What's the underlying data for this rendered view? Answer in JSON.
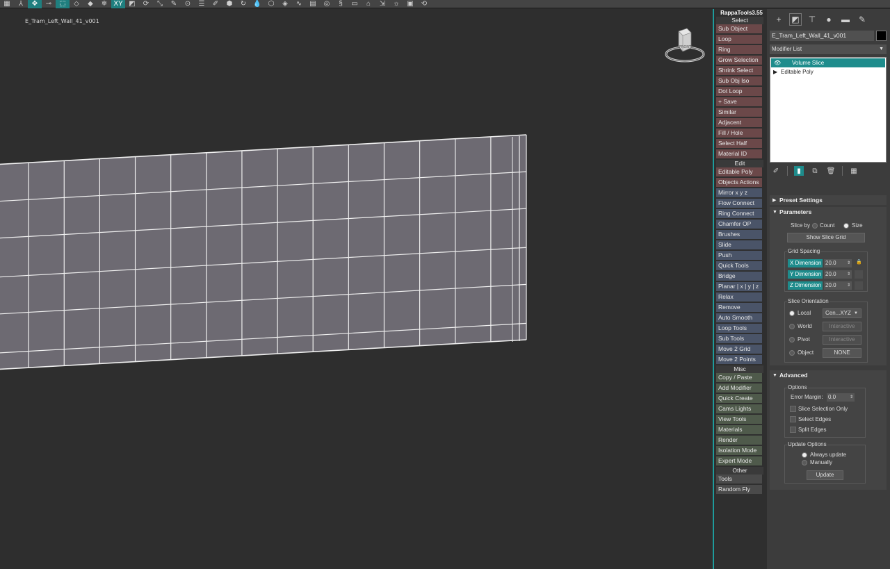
{
  "toolbar": {
    "icons": [
      "grid-icon",
      "select-icon",
      "move-icon",
      "link-icon",
      "select-region-icon",
      "bend-icon",
      "pin-icon",
      "snowflake-icon",
      "xy-icon",
      "snap-icon",
      "rotate-icon",
      "scale-icon",
      "paint-icon",
      "magnet-icon",
      "layers-icon",
      "edit-icon",
      "render-icon",
      "reload-icon",
      "water-icon",
      "cube-green-icon",
      "cube-icon",
      "curve-icon",
      "list-icon",
      "globe-icon",
      "script-icon",
      "box-icon",
      "camera-icon",
      "light-icon",
      "sun-icon",
      "frame-icon",
      "refresh-icon"
    ]
  },
  "viewport": {
    "label": "E_Tram_Left_Wall_41_v001",
    "viewcube_label": "FRONT"
  },
  "rappa": {
    "title": "RappaTools3.55",
    "sections": [
      {
        "header": "Select",
        "buttons": [
          {
            "label": "Sub Object",
            "color": "red"
          },
          {
            "label": "Loop",
            "color": "red"
          },
          {
            "label": "Ring",
            "color": "red"
          },
          {
            "label": "Grow Selection",
            "color": "red"
          },
          {
            "label": "Shrink Select",
            "color": "red"
          },
          {
            "label": "Sub Obj Iso",
            "color": "red"
          },
          {
            "label": "Dot Loop",
            "color": "red"
          },
          {
            "label": "+ Save",
            "color": "red"
          },
          {
            "label": "Similar",
            "color": "red"
          },
          {
            "label": "Adjacent",
            "color": "red"
          },
          {
            "label": "Fill / Hole",
            "color": "red"
          },
          {
            "label": "Select Half",
            "color": "red"
          },
          {
            "label": "Material ID",
            "color": "red"
          }
        ]
      },
      {
        "header": "Edit",
        "buttons": [
          {
            "label": "Editable Poly",
            "color": "red"
          },
          {
            "label": "Objects Actions",
            "color": "red"
          },
          {
            "label": "Mirror   x  y  z",
            "color": "blue"
          },
          {
            "label": "Flow Connect",
            "color": "blue"
          },
          {
            "label": "Ring Connect",
            "color": "blue"
          },
          {
            "label": "Chamfer OP",
            "color": "blue"
          },
          {
            "label": "Brushes",
            "color": "blue"
          },
          {
            "label": "Slide",
            "color": "blue"
          },
          {
            "label": "Push",
            "color": "blue"
          },
          {
            "label": "Quick Tools",
            "color": "blue"
          },
          {
            "label": "Bridge",
            "color": "blue"
          },
          {
            "label": "Planar | x | y | z",
            "color": "blue"
          },
          {
            "label": "Relax",
            "color": "blue"
          },
          {
            "label": "Remove",
            "color": "blue"
          },
          {
            "label": "Auto Smooth",
            "color": "blue"
          },
          {
            "label": "Loop Tools",
            "color": "blue"
          },
          {
            "label": "Sub Tools",
            "color": "blue"
          },
          {
            "label": "Move 2 Grid",
            "color": "blue"
          },
          {
            "label": "Move 2 Points",
            "color": "blue"
          }
        ]
      },
      {
        "header": "Misc",
        "buttons": [
          {
            "label": "Copy / Paste",
            "color": "green"
          },
          {
            "label": "Add Modifier",
            "color": "green"
          },
          {
            "label": "Quick Create",
            "color": "green"
          },
          {
            "label": "Cams Lights",
            "color": "green"
          },
          {
            "label": "View Tools",
            "color": "green"
          },
          {
            "label": "Materials",
            "color": "green"
          },
          {
            "label": "Render",
            "color": "green"
          },
          {
            "label": "Isolation Mode",
            "color": "green"
          },
          {
            "label": "Expert Mode",
            "color": "green"
          }
        ]
      },
      {
        "header": "Other",
        "buttons": [
          {
            "label": "Tools",
            "color": "gray"
          },
          {
            "label": "Random Fly",
            "color": "gray"
          }
        ]
      }
    ]
  },
  "cmd": {
    "object_name": "E_Tram_Left_Wall_41_v001",
    "modifier_list": "Modifier List",
    "stack": [
      "Volume Slice",
      "Editable Poly"
    ],
    "rollouts": {
      "preset": "Preset Settings",
      "parameters": "Parameters",
      "advanced": "Advanced"
    },
    "params": {
      "slice_by": "Slice by",
      "count": "Count",
      "size": "Size",
      "show_grid": "Show Slice Grid",
      "grid_spacing": "Grid Spacing",
      "x_dim": "X Dimension",
      "y_dim": "Y Dimension",
      "z_dim": "Z Dimension",
      "x_val": "20.0",
      "y_val": "20.0",
      "z_val": "20.0",
      "orientation": "Slice Orientation",
      "local": "Local",
      "world": "World",
      "pivot": "Pivot",
      "object": "Object",
      "local_val": "Cen...XYZ",
      "world_val": "Interactive",
      "pivot_val": "Interactive",
      "object_val": "NONE"
    },
    "advanced": {
      "options": "Options",
      "error_margin": "Error Margin:",
      "error_val": "0.0",
      "slice_sel_only": "Slice Selection Only",
      "select_edges": "Select Edges",
      "split_edges": "Split Edges",
      "update_options": "Update Options",
      "always": "Always update",
      "manually": "Manually",
      "update": "Update"
    }
  },
  "colors": {
    "accent": "#1e8c8c",
    "mesh_fill": "#6d6a72",
    "wire": "#f0f0f0"
  }
}
